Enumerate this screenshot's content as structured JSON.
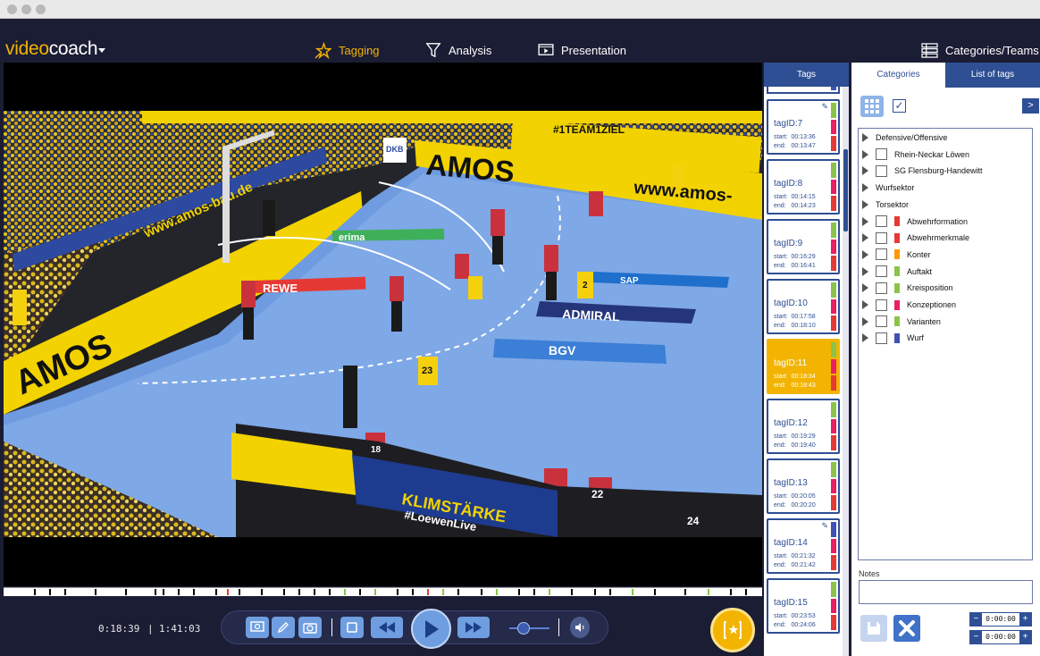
{
  "app": {
    "logo_part1": "video",
    "logo_part2": "coach"
  },
  "nav": {
    "tagging": "Tagging",
    "analysis": "Analysis",
    "presentation": "Presentation",
    "categories_teams": "Categories/Teams"
  },
  "video": {
    "board_texts": {
      "amos": "AMOS",
      "rewe": "REWE",
      "erima": "erima",
      "admiral": "ADMIRAL",
      "bgv": "BGV",
      "sap": "SAP",
      "amos_url": "www.amos-",
      "dkb": "DKB",
      "team_ziel": "#1TEAM1ZIEL",
      "klimstaerke": "KLIMSTÄRKE",
      "loewen_live": "#LoewenLive",
      "amos_bau": "www.amos-bau.de"
    },
    "jersey_numbers": {
      "yellow_right": "2",
      "yellow_center": "23",
      "bench_red_1": "18",
      "bench_red_2": "22",
      "bench_red_3": "24"
    }
  },
  "player": {
    "current_time": "0:18:39",
    "separator": "|",
    "total_time": "1:41:03",
    "volume_level": 0.35,
    "timeline_marks": [
      {
        "pos": 0.04,
        "color": "#000000"
      },
      {
        "pos": 0.06,
        "color": "#000000"
      },
      {
        "pos": 0.08,
        "color": "#000000"
      },
      {
        "pos": 0.12,
        "color": "#000000"
      },
      {
        "pos": 0.16,
        "color": "#000000"
      },
      {
        "pos": 0.2,
        "color": "#000000"
      },
      {
        "pos": 0.21,
        "color": "#000000"
      },
      {
        "pos": 0.23,
        "color": "#000000"
      },
      {
        "pos": 0.25,
        "color": "#000000"
      },
      {
        "pos": 0.28,
        "color": "#000000"
      },
      {
        "pos": 0.295,
        "color": "#e53935"
      },
      {
        "pos": 0.31,
        "color": "#000000"
      },
      {
        "pos": 0.34,
        "color": "#000000"
      },
      {
        "pos": 0.37,
        "color": "#000000"
      },
      {
        "pos": 0.39,
        "color": "#000000"
      },
      {
        "pos": 0.41,
        "color": "#000000"
      },
      {
        "pos": 0.43,
        "color": "#000000"
      },
      {
        "pos": 0.45,
        "color": "#8bc34a"
      },
      {
        "pos": 0.47,
        "color": "#000000"
      },
      {
        "pos": 0.49,
        "color": "#8bc34a"
      },
      {
        "pos": 0.52,
        "color": "#000000"
      },
      {
        "pos": 0.54,
        "color": "#000000"
      },
      {
        "pos": 0.56,
        "color": "#e53935"
      },
      {
        "pos": 0.58,
        "color": "#8bc34a"
      },
      {
        "pos": 0.6,
        "color": "#000000"
      },
      {
        "pos": 0.63,
        "color": "#000000"
      },
      {
        "pos": 0.65,
        "color": "#8bc34a"
      },
      {
        "pos": 0.68,
        "color": "#000000"
      },
      {
        "pos": 0.7,
        "color": "#000000"
      },
      {
        "pos": 0.72,
        "color": "#8bc34a"
      },
      {
        "pos": 0.75,
        "color": "#000000"
      },
      {
        "pos": 0.78,
        "color": "#000000"
      },
      {
        "pos": 0.8,
        "color": "#000000"
      },
      {
        "pos": 0.83,
        "color": "#8bc34a"
      },
      {
        "pos": 0.86,
        "color": "#000000"
      },
      {
        "pos": 0.9,
        "color": "#000000"
      },
      {
        "pos": 0.93,
        "color": "#8bc34a"
      },
      {
        "pos": 0.96,
        "color": "#000000"
      },
      {
        "pos": 0.98,
        "color": "#000000"
      }
    ]
  },
  "tags_panel": {
    "header": "Tags",
    "cards": [
      {
        "id": "tagID:7",
        "start": "start:  00:13:36",
        "end": "end:   00:13:47",
        "active": false,
        "edited": true,
        "colors": [
          "#8bc34a",
          "#e91e63",
          "#e53935"
        ]
      },
      {
        "id": "tagID:8",
        "start": "start:  00:14:15",
        "end": "end:   00:14:23",
        "active": false,
        "edited": false,
        "colors": [
          "#8bc34a",
          "#e91e63",
          "#e53935"
        ]
      },
      {
        "id": "tagID:9",
        "start": "start:  00:16:29",
        "end": "end:   00:16:41",
        "active": false,
        "edited": false,
        "colors": [
          "#8bc34a",
          "#e91e63",
          "#e53935"
        ]
      },
      {
        "id": "tagID:10",
        "start": "start:  00:17:58",
        "end": "end:   00:18:10",
        "active": false,
        "edited": false,
        "colors": [
          "#8bc34a",
          "#e91e63",
          "#e53935"
        ]
      },
      {
        "id": "tagID:11",
        "start": "start:  00:18:34",
        "end": "end:   00:18:43",
        "active": true,
        "edited": false,
        "colors": [
          "#8bc34a",
          "#e91e63",
          "#e53935"
        ]
      },
      {
        "id": "tagID:12",
        "start": "start:  00:19:29",
        "end": "end:   00:19:40",
        "active": false,
        "edited": false,
        "colors": [
          "#8bc34a",
          "#e91e63",
          "#e53935"
        ]
      },
      {
        "id": "tagID:13",
        "start": "start:  00:20:05",
        "end": "end:   00:20:20",
        "active": false,
        "edited": false,
        "colors": [
          "#8bc34a",
          "#e91e63",
          "#e53935"
        ]
      },
      {
        "id": "tagID:14",
        "start": "start:  00:21:32",
        "end": "end:   00:21:42",
        "active": false,
        "edited": true,
        "colors": [
          "#3f51b5",
          "#e91e63",
          "#e53935"
        ]
      },
      {
        "id": "tagID:15",
        "start": "start:  00:23:53",
        "end": "end:   00:24:06",
        "active": false,
        "edited": false,
        "colors": [
          "#8bc34a",
          "#e91e63",
          "#e53935"
        ]
      }
    ]
  },
  "right_panel": {
    "tab_categories": "Categories",
    "tab_list": "List of tags",
    "check_mark": "✓",
    "expand_label": ">",
    "tree": [
      {
        "label": "Defensive/Offensive",
        "checkbox": false,
        "color": null
      },
      {
        "label": "Rhein-Neckar Löwen",
        "checkbox": true,
        "color": null
      },
      {
        "label": "SG Flensburg-Handewitt",
        "checkbox": true,
        "color": null
      },
      {
        "label": "Wurfsektor",
        "checkbox": false,
        "color": null
      },
      {
        "label": "Torsektor",
        "checkbox": false,
        "color": null
      },
      {
        "label": "Abwehrformation",
        "checkbox": true,
        "color": "#e53935"
      },
      {
        "label": "Abwehrmerkmale",
        "checkbox": true,
        "color": "#e53935"
      },
      {
        "label": "Konter",
        "checkbox": true,
        "color": "#ff9800"
      },
      {
        "label": "Auftakt",
        "checkbox": true,
        "color": "#8bc34a"
      },
      {
        "label": "Kreisposition",
        "checkbox": true,
        "color": "#8bc34a"
      },
      {
        "label": "Konzeptionen",
        "checkbox": true,
        "color": "#e91e63"
      },
      {
        "label": "Varianten",
        "checkbox": true,
        "color": "#8bc34a"
      },
      {
        "label": "Wurf",
        "checkbox": true,
        "color": "#3f51b5"
      }
    ],
    "notes_label": "Notes",
    "notes_value": "",
    "stepper_start": "0:00:00",
    "stepper_end": "0:00:00",
    "minus": "−",
    "plus": "+"
  },
  "colors": {
    "accent": "#f2b400",
    "primary": "#2e4f93",
    "app_bg": "#1b1d35"
  }
}
